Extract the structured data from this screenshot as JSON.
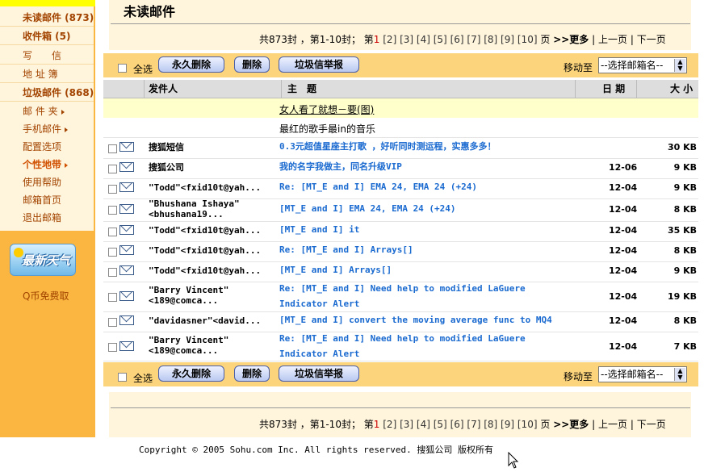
{
  "sidebar": {
    "items": [
      {
        "label": "未读邮件 (873)"
      },
      {
        "label": "收件箱 (5)"
      },
      {
        "label": "写　　信"
      },
      {
        "label": "地 址 簿"
      },
      {
        "label": "垃圾邮件 (868)"
      },
      {
        "label": "邮 件 夹"
      },
      {
        "label": "手机邮件"
      },
      {
        "label": "配置选项"
      },
      {
        "label": "个性地带"
      },
      {
        "label": "使用帮助"
      },
      {
        "label": "邮箱首页"
      },
      {
        "label": "退出邮箱"
      }
    ],
    "weather_label": "最新天气",
    "qcoin": "Q币免费取"
  },
  "main": {
    "title": "未读邮件",
    "pager": {
      "summary": "共873封 ，第1-10封； 第",
      "pages": [
        "1",
        "[2]",
        "[3]",
        "[4]",
        "[5]",
        "[6]",
        "[7]",
        "[8]",
        "[9]",
        "[10]"
      ],
      "page_suffix": "页",
      "more": ">>更多",
      "prev": "上一页",
      "next": "下一页",
      "sep": "|"
    },
    "toolbar": {
      "select_all": "全选",
      "delete_forever": "永久删除",
      "delete": "删除",
      "report_spam": "垃圾信举报",
      "move_to": "移动至",
      "folder_select": "--选择邮箱名--"
    },
    "columns": {
      "from": "发件人",
      "subject": "主　题",
      "date": "日 期",
      "size": "大 小"
    },
    "ads": [
      "女人看了就想－要(图)",
      "最红的歌手最in的音乐"
    ],
    "emails": [
      {
        "from": "搜狐短信",
        "subject": "0.3元超值星座主打歌 ，好听同时测运程，实惠多多！",
        "date": "",
        "size": "30 KB"
      },
      {
        "from": "搜狐公司",
        "subject": "我的名字我做主，同名升级VIP",
        "date": "12-06",
        "size": "9 KB"
      },
      {
        "from": "\"Todd\"<fxid10t@yah...",
        "subject": "Re: [MT_E and I] EMA 24, EMA 24 (+24)",
        "date": "12-04",
        "size": "9 KB"
      },
      {
        "from": "\"Bhushana Ishaya\"<bhushana19...",
        "subject": "[MT_E and I] EMA 24, EMA 24 (+24)",
        "date": "12-04",
        "size": "8 KB"
      },
      {
        "from": "\"Todd\"<fxid10t@yah...",
        "subject": "[MT_E and I] it",
        "date": "12-04",
        "size": "35 KB"
      },
      {
        "from": "\"Todd\"<fxid10t@yah...",
        "subject": "Re: [MT_E and I] Arrays[]",
        "date": "12-04",
        "size": "8 KB"
      },
      {
        "from": "\"Todd\"<fxid10t@yah...",
        "subject": "[MT_E and I] Arrays[]",
        "date": "12-04",
        "size": "9 KB"
      },
      {
        "from": "\"Barry Vincent\"<189@comca...",
        "subject": "Re: [MT_E and I] Need help to modified LaGuere Indicator Alert",
        "date": "12-04",
        "size": "19 KB"
      },
      {
        "from": "\"davidasner\"<david...",
        "subject": "[MT_E and I] convert the moving average func to MQ4",
        "date": "12-04",
        "size": "8 KB"
      },
      {
        "from": "\"Barry Vincent\"<189@comca...",
        "subject": "Re: [MT_E and I] Need help to modified LaGuere Indicator Alert",
        "date": "12-04",
        "size": "7 KB"
      }
    ]
  },
  "footer": "Copyright © 2005 Sohu.com Inc. All rights reserved. 搜狐公司 版权所有"
}
